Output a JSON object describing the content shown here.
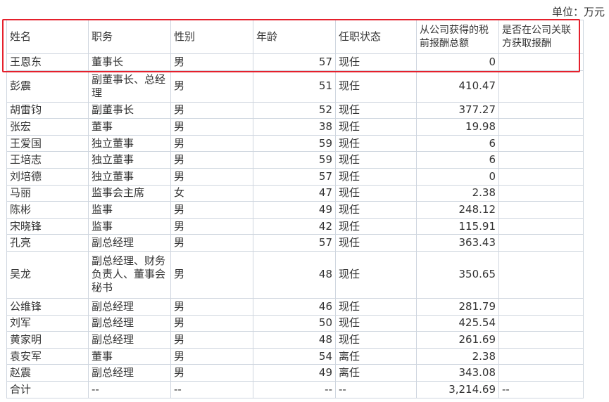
{
  "unit_label": "单位：万元",
  "headers": {
    "name": "姓名",
    "position": "职务",
    "gender": "性别",
    "age": "年龄",
    "status": "任职状态",
    "pay": "从公司获得的税前报酬总额",
    "related": "是否在公司关联方获取报酬"
  },
  "rows": [
    {
      "name": "王恩东",
      "position": "董事长",
      "gender": "男",
      "age": "57",
      "status": "现任",
      "pay": "0",
      "related": ""
    },
    {
      "name": "彭震",
      "position": "副董事长、总经理",
      "gender": "男",
      "age": "51",
      "status": "现任",
      "pay": "410.47",
      "related": ""
    },
    {
      "name": "胡雷钧",
      "position": "副董事长",
      "gender": "男",
      "age": "52",
      "status": "现任",
      "pay": "377.27",
      "related": ""
    },
    {
      "name": "张宏",
      "position": "董事",
      "gender": "男",
      "age": "38",
      "status": "现任",
      "pay": "19.98",
      "related": ""
    },
    {
      "name": "王爱国",
      "position": "独立董事",
      "gender": "男",
      "age": "59",
      "status": "现任",
      "pay": "6",
      "related": ""
    },
    {
      "name": "王培志",
      "position": "独立董事",
      "gender": "男",
      "age": "59",
      "status": "现任",
      "pay": "6",
      "related": ""
    },
    {
      "name": "刘培德",
      "position": "独立董事",
      "gender": "男",
      "age": "57",
      "status": "现任",
      "pay": "0",
      "related": ""
    },
    {
      "name": "马丽",
      "position": "监事会主席",
      "gender": "女",
      "age": "47",
      "status": "现任",
      "pay": "2.38",
      "related": ""
    },
    {
      "name": "陈彬",
      "position": "监事",
      "gender": "男",
      "age": "49",
      "status": "现任",
      "pay": "248.12",
      "related": ""
    },
    {
      "name": "宋晓锋",
      "position": "监事",
      "gender": "男",
      "age": "42",
      "status": "现任",
      "pay": "115.91",
      "related": ""
    },
    {
      "name": "孔亮",
      "position": "副总经理",
      "gender": "男",
      "age": "57",
      "status": "现任",
      "pay": "363.43",
      "related": ""
    },
    {
      "name": "吴龙",
      "position": "副总经理、财务负责人、董事会秘书",
      "gender": "男",
      "age": "48",
      "status": "现任",
      "pay": "350.65",
      "related": ""
    },
    {
      "name": "公维锋",
      "position": "副总经理",
      "gender": "男",
      "age": "46",
      "status": "现任",
      "pay": "281.79",
      "related": ""
    },
    {
      "name": "刘军",
      "position": "副总经理",
      "gender": "男",
      "age": "50",
      "status": "现任",
      "pay": "425.54",
      "related": ""
    },
    {
      "name": "黄家明",
      "position": "副总经理",
      "gender": "男",
      "age": "48",
      "status": "现任",
      "pay": "261.69",
      "related": ""
    },
    {
      "name": "袁安军",
      "position": "董事",
      "gender": "男",
      "age": "54",
      "status": "离任",
      "pay": "2.38",
      "related": ""
    },
    {
      "name": "赵震",
      "position": "副总经理",
      "gender": "男",
      "age": "49",
      "status": "离任",
      "pay": "343.08",
      "related": ""
    }
  ],
  "total": {
    "name": "合计",
    "position": "--",
    "gender": "--",
    "age": "--",
    "status": "--",
    "pay": "3,214.69",
    "related": "--"
  },
  "accent_color": "#e5202c"
}
